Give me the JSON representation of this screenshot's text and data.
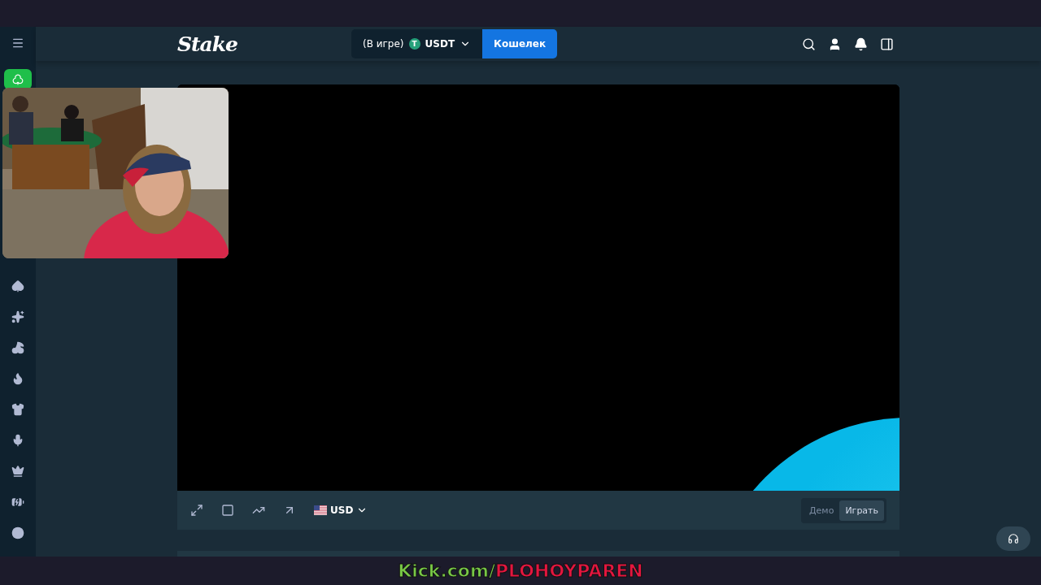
{
  "header": {
    "logo": "Stake",
    "balance": {
      "status": "(В игре)",
      "coin_symbol": "T",
      "currency": "USDT"
    },
    "wallet_button": "Кошелек"
  },
  "toolbar": {
    "currency": "USD",
    "modes": [
      {
        "label": "Демо",
        "selected": false
      },
      {
        "label": "Играть",
        "selected": true
      }
    ]
  },
  "banner": [
    {
      "text": "Kick.com/",
      "color": "#78c846"
    },
    {
      "text": "PLOHOYPAREN",
      "color": "#e3163f"
    }
  ]
}
